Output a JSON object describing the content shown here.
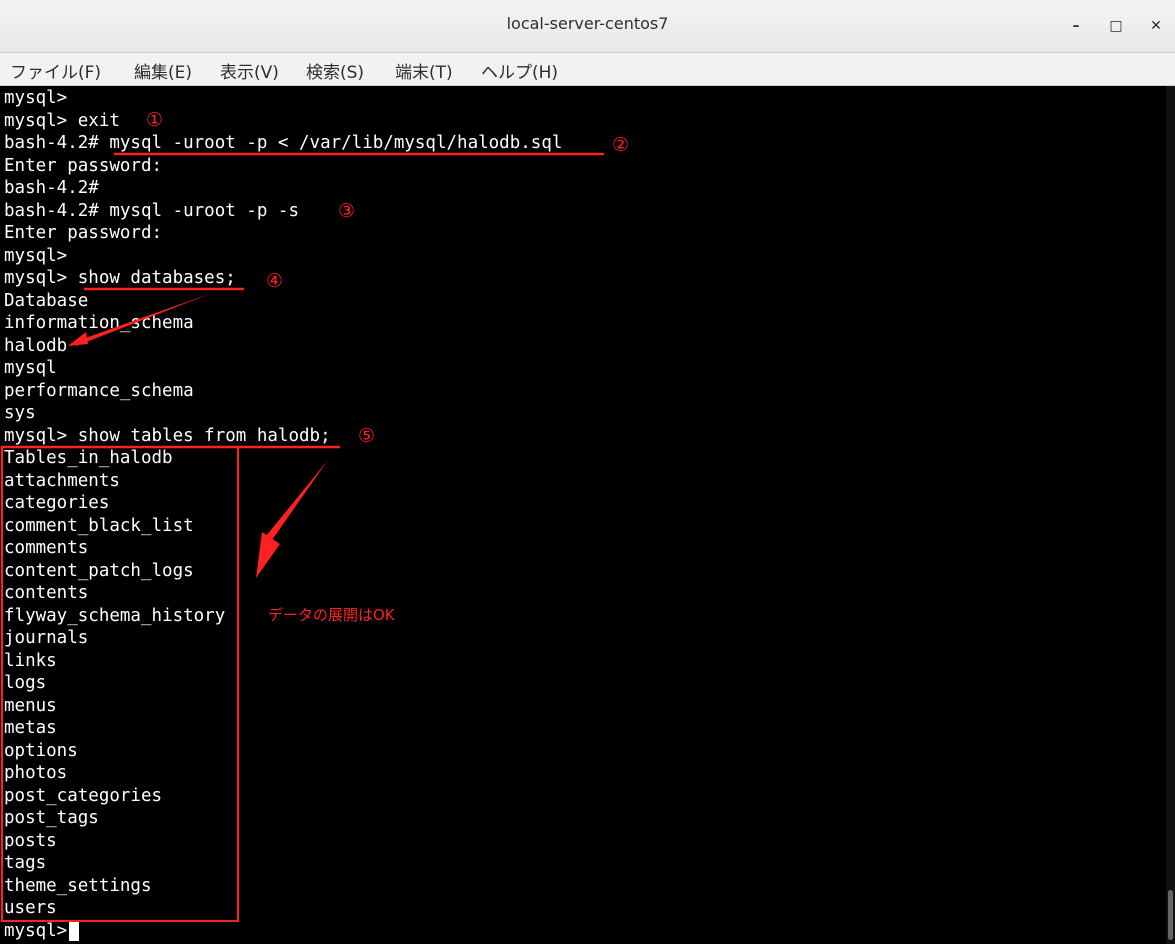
{
  "window": {
    "title": "local-server-centos7",
    "minimize": "–",
    "maximize": "□",
    "close": "✕"
  },
  "menu": {
    "file": "ファイル(F)",
    "edit": "編集(E)",
    "view": "表示(V)",
    "search": "検索(S)",
    "terminal": "端末(T)",
    "help": "ヘルプ(H)"
  },
  "terminal": {
    "lines": [
      "mysql>",
      "mysql> exit",
      "bash-4.2# mysql -uroot -p < /var/lib/mysql/halodb.sql",
      "Enter password:",
      "bash-4.2#",
      "bash-4.2# mysql -uroot -p -s",
      "Enter password:",
      "mysql>",
      "mysql> show databases;",
      "Database",
      "information_schema",
      "halodb",
      "mysql",
      "performance_schema",
      "sys",
      "mysql> show tables from halodb;",
      "Tables_in_halodb",
      "attachments",
      "categories",
      "comment_black_list",
      "comments",
      "content_patch_logs",
      "contents",
      "flyway_schema_history",
      "journals",
      "links",
      "logs",
      "menus",
      "metas",
      "options",
      "photos",
      "post_categories",
      "post_tags",
      "posts",
      "tags",
      "theme_settings",
      "users",
      "mysql>"
    ]
  },
  "annotations": {
    "step1": "①",
    "step2": "②",
    "step3": "③",
    "step4": "④",
    "step5": "⑤",
    "note": "データの展開はOK",
    "color": "#ff2020"
  }
}
